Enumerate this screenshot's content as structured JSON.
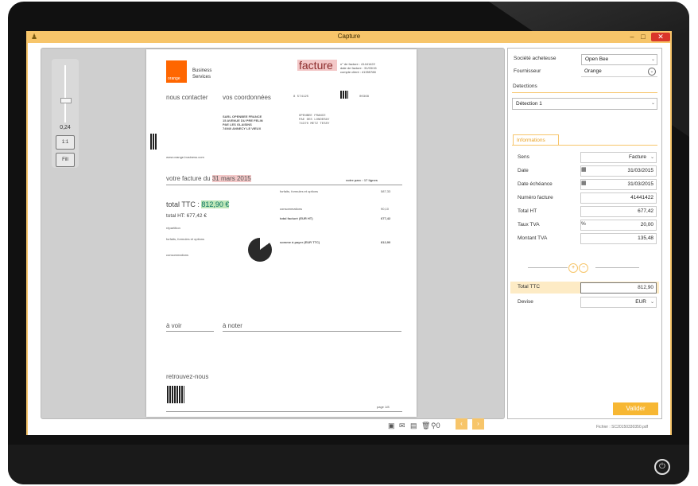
{
  "window": {
    "title": "Capture",
    "minimize": "‒",
    "maximize": "□",
    "close": "✕"
  },
  "viewer": {
    "zoom_value": "0,24",
    "zoom_level": 0.24,
    "btn_11": "1:1",
    "btn_fill": "Fill"
  },
  "document": {
    "logo_text": "orange",
    "business": "Business Services",
    "title": "facture",
    "meta_lines": [
      "n° de facture : 41441422",
      "date de facture : 31/03/15",
      "compte client : 41355788"
    ],
    "contact_head": "nous contacter",
    "coords_head": "vos coordonnées",
    "ref_left": "8 574125",
    "ref_right": "00368",
    "address": [
      "SARL OPENBEE FRANCE",
      "15 AVENUE DU PRE FELIN",
      "PAE LES GLAISINS",
      "74940 ANNECY LE VIEUX"
    ],
    "address2": [
      "OPENBEE FRANCE",
      "PAE DES LONDERAY",
      "74370 METZ TESSY"
    ],
    "website": "www.orange-business.com",
    "invoice_head": "votre facture du",
    "invoice_date": "31 mars 2015",
    "invoice_pages": "votre parc : 17 lignes",
    "total_ttc_label": "total TTC :",
    "total_ttc_value": "812,90 €",
    "total_ht": "total HT: 677,42 €",
    "legend": [
      "répartition",
      "forfaits, formules et options",
      "consommations"
    ],
    "lines": [
      {
        "label": "forfaits, formules et options",
        "value": "587,33"
      },
      {
        "label": "consommations",
        "value": "90,10"
      },
      {
        "label": "total facturé (EUR HT)",
        "value": "677,42"
      },
      {
        "label": "somme à payer (EUR TTC)",
        "value": "812,90"
      }
    ],
    "avoir": "à voir",
    "anoter": "à noter",
    "retrouvez": "retrouvez-nous",
    "page": "page 1/8"
  },
  "panel": {
    "societe_label": "Société acheteuse",
    "societe_value": "Open Bee",
    "fournisseur_label": "Fournisseur",
    "fournisseur_value": "Orange",
    "detections_label": "Detections",
    "detection_value": "Détection 1",
    "tab_informations": "Informations",
    "fields": [
      {
        "label": "Sens",
        "value": "Facture"
      },
      {
        "label": "Date",
        "value": "31/03/2015"
      },
      {
        "label": "Date échéance",
        "value": "31/03/2015"
      },
      {
        "label": "Numéro facture",
        "value": "41441422"
      },
      {
        "label": "Total HT",
        "value": "677,42"
      },
      {
        "label": "Taux TVA",
        "value": "20,00",
        "prefix": "%"
      },
      {
        "label": "Montant TVA",
        "value": "135,48"
      }
    ],
    "total_ttc_label": "Total TTC",
    "total_ttc_value": "812,90",
    "devise_label": "Devise",
    "devise_value": "EUR",
    "valider": "Valider",
    "status": "Fichier :   SC20150330350.pdf"
  },
  "toolbar": {
    "attachments": "0"
  },
  "colors": {
    "accent": "#f7c56a",
    "button": "#f7b733",
    "frame": "#111111"
  }
}
